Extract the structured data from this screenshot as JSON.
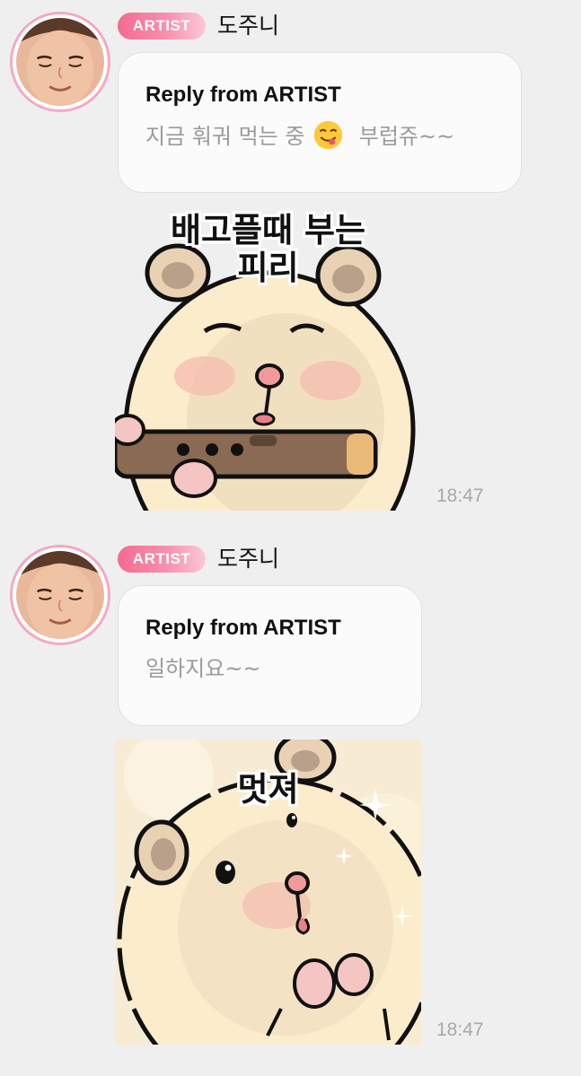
{
  "messages": [
    {
      "badge": "ARTIST",
      "sender": "도주니",
      "reply_title": "Reply from ARTIST",
      "reply_text_before": "지금 훠궈 먹는 중",
      "reply_text_after": "부럽쥬~~",
      "emoji_icon": "yum-face-emoji",
      "sticker_caption_line1": "배고플때 부는",
      "sticker_caption_line2": "피리",
      "time": "18:47"
    },
    {
      "badge": "ARTIST",
      "sender": "도주니",
      "reply_title": "Reply from ARTIST",
      "reply_text": "일하지요~~",
      "sticker_caption": "멋져",
      "time": "18:47"
    }
  ],
  "colors": {
    "background": "#efefef",
    "badge_pink": "#f56b90",
    "avatar_ring": "#f4a9c4",
    "bubble": "#fbfbfb",
    "time_gray": "#a8a8a8"
  }
}
